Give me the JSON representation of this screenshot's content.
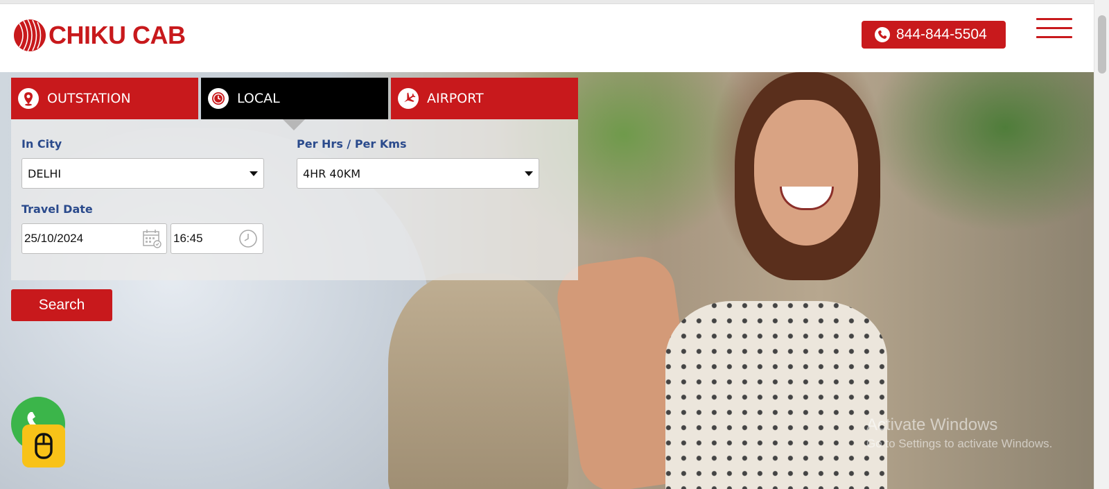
{
  "header": {
    "logo_text": "CHIKU CAB",
    "phone": "844-844-5504",
    "accent_color": "#c8191c"
  },
  "tabs": [
    {
      "label": "OUTSTATION",
      "icon": "location-pin-icon",
      "active": false
    },
    {
      "label": "LOCAL",
      "icon": "clock-icon",
      "active": true
    },
    {
      "label": "AIRPORT",
      "icon": "airplane-icon",
      "active": false
    }
  ],
  "form": {
    "city_label": "In City",
    "city_value": "DELHI",
    "package_label": "Per Hrs / Per Kms",
    "package_value": "4HR 40KM",
    "date_label": "Travel Date",
    "date_value": "25/10/2024",
    "time_value": "16:45",
    "search_label": "Search"
  },
  "os_watermark": {
    "line1": "Activate Windows",
    "line2": "Go to Settings to activate Windows."
  }
}
